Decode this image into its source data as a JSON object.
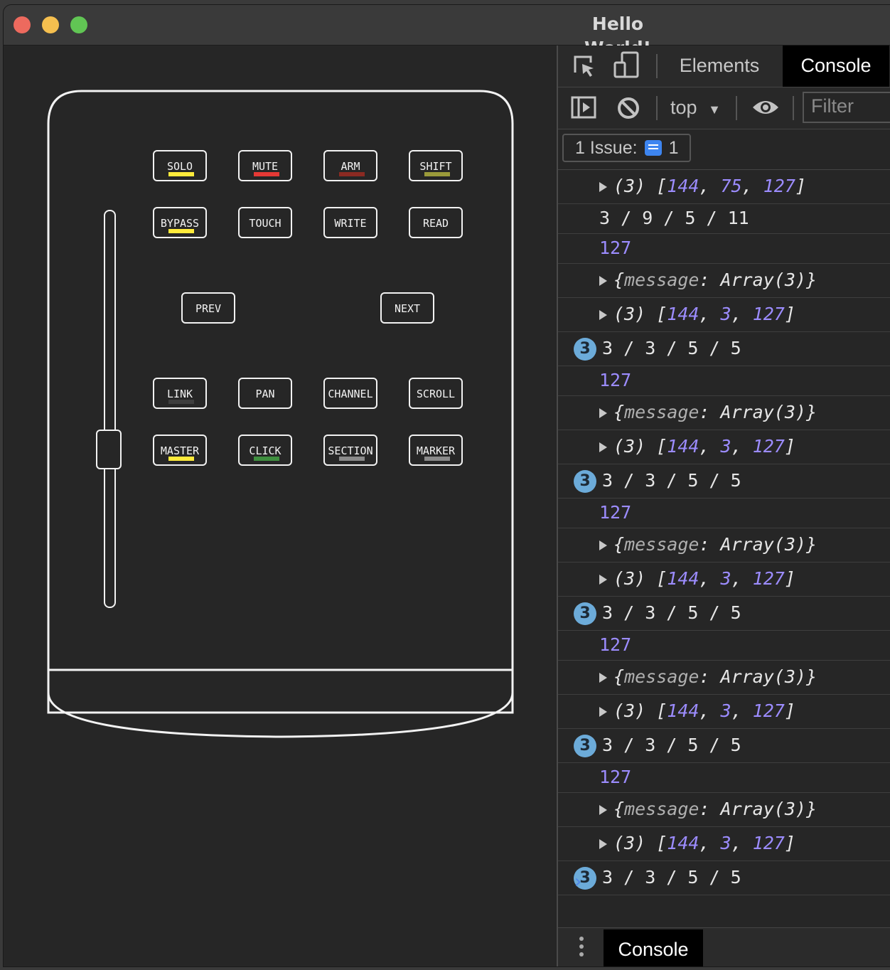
{
  "window": {
    "title": "Hello World!"
  },
  "controller": {
    "pads": [
      {
        "id": "solo",
        "label": "SOLO",
        "led": "#ffeb3b"
      },
      {
        "id": "mute",
        "label": "MUTE",
        "led": "#e53935"
      },
      {
        "id": "arm",
        "label": "ARM",
        "led": "#8b2a22"
      },
      {
        "id": "shift",
        "label": "SHIFT",
        "led": "#9a9a3a"
      },
      {
        "id": "bypass",
        "label": "BYPASS",
        "led": "#ffeb3b"
      },
      {
        "id": "touch",
        "label": "TOUCH",
        "led": null
      },
      {
        "id": "write",
        "label": "WRITE",
        "led": null
      },
      {
        "id": "read",
        "label": "READ",
        "led": null
      },
      {
        "id": "prev",
        "label": "PREV",
        "led": null
      },
      {
        "id": "next",
        "label": "NEXT",
        "led": null
      },
      {
        "id": "link",
        "label": "LINK",
        "led": "#3e3e3e"
      },
      {
        "id": "pan",
        "label": "PAN",
        "led": null
      },
      {
        "id": "channel",
        "label": "CHANNEL",
        "led": null
      },
      {
        "id": "scroll",
        "label": "SCROLL",
        "led": null
      },
      {
        "id": "master",
        "label": "MASTER",
        "led": "#ffeb3b"
      },
      {
        "id": "click",
        "label": "CLICK",
        "led": "#3f8f3f"
      },
      {
        "id": "section",
        "label": "SECTION",
        "led": "#8a8a8a"
      },
      {
        "id": "marker",
        "label": "MARKER",
        "led": "#8a8a8a"
      }
    ]
  },
  "devtools": {
    "tabs": {
      "elements": "Elements",
      "console": "Console"
    },
    "toolbar": {
      "context": "top",
      "filter_placeholder": "Filter"
    },
    "issues": {
      "label": "1 Issue:",
      "count": "1"
    },
    "colors": {
      "link_blue": "#4f86e8",
      "number_purple": "#9c8cff",
      "badge": "#6cabd9"
    },
    "log": [
      {
        "type": "array",
        "len": "(3)",
        "vals": [
          "144",
          "75",
          "127"
        ]
      },
      {
        "type": "text",
        "text": "3 / 9 / 5 / 11"
      },
      {
        "type": "number",
        "text": "127"
      },
      {
        "type": "object",
        "key": "message",
        "val": "Array(3)"
      },
      {
        "type": "array",
        "len": "(3)",
        "vals": [
          "144",
          "3",
          "127"
        ]
      },
      {
        "type": "repeat",
        "count": "3",
        "text": "3 / 3 / 5 / 5"
      },
      {
        "type": "number",
        "text": "127"
      },
      {
        "type": "object",
        "key": "message",
        "val": "Array(3)"
      },
      {
        "type": "array",
        "len": "(3)",
        "vals": [
          "144",
          "3",
          "127"
        ]
      },
      {
        "type": "repeat",
        "count": "3",
        "text": "3 / 3 / 5 / 5"
      },
      {
        "type": "number",
        "text": "127"
      },
      {
        "type": "object",
        "key": "message",
        "val": "Array(3)"
      },
      {
        "type": "array",
        "len": "(3)",
        "vals": [
          "144",
          "3",
          "127"
        ]
      },
      {
        "type": "repeat",
        "count": "3",
        "text": "3 / 3 / 5 / 5"
      },
      {
        "type": "number",
        "text": "127"
      },
      {
        "type": "object",
        "key": "message",
        "val": "Array(3)"
      },
      {
        "type": "array",
        "len": "(3)",
        "vals": [
          "144",
          "3",
          "127"
        ]
      },
      {
        "type": "repeat",
        "count": "3",
        "text": "3 / 3 / 5 / 5"
      },
      {
        "type": "number",
        "text": "127"
      },
      {
        "type": "object",
        "key": "message",
        "val": "Array(3)"
      },
      {
        "type": "array",
        "len": "(3)",
        "vals": [
          "144",
          "3",
          "127"
        ]
      },
      {
        "type": "repeat",
        "count": "3",
        "text": "3 / 3 / 5 / 5"
      }
    ],
    "prompt": "›",
    "drawer": {
      "tab": "Console"
    }
  }
}
